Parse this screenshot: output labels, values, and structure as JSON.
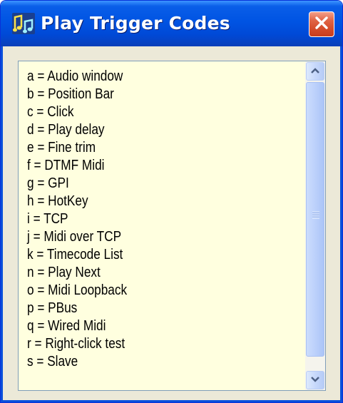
{
  "window": {
    "title": "Play Trigger Codes",
    "icons": {
      "app": "music-notes-icon",
      "close": "close-x-icon"
    }
  },
  "list": {
    "items": [
      "a = Audio window",
      "b = Position Bar",
      "c = Click",
      "d = Play delay",
      "e = Fine trim",
      "f = DTMF Midi",
      "g = GPI",
      "h = HotKey",
      "i = TCP",
      "j = Midi over TCP",
      "k = Timecode List",
      "n = Play Next",
      "o = Midi Loopback",
      "p = PBus",
      "q = Wired Midi",
      "r = Right-click test",
      "s = Slave"
    ]
  },
  "scrollbar": {
    "position_fraction": 0.0,
    "icons": {
      "up": "scroll-up-arrow-icon",
      "down": "scroll-down-arrow-icon",
      "grip": "grip-lines-icon"
    }
  },
  "colors": {
    "titlebar": "#0054e3",
    "list_background": "#ffffdf",
    "window_body": "#ece9d8",
    "close_button": "#d44b29",
    "scrollbar_button": "#c7d9fb"
  }
}
